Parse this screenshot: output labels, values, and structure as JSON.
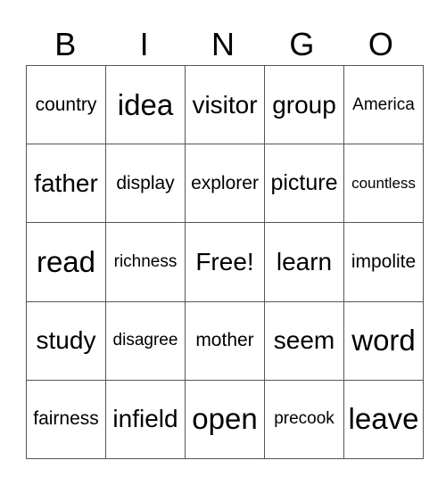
{
  "header": [
    "B",
    "I",
    "N",
    "G",
    "O"
  ],
  "rows": [
    [
      "country",
      "idea",
      "visitor",
      "group",
      "America"
    ],
    [
      "father",
      "display",
      "explorer",
      "picture",
      "countless"
    ],
    [
      "read",
      "richness",
      "Free!",
      "learn",
      "impolite"
    ],
    [
      "study",
      "disagree",
      "mother",
      "seem",
      "word"
    ],
    [
      "fairness",
      "infield",
      "open",
      "precook",
      "leave"
    ]
  ]
}
